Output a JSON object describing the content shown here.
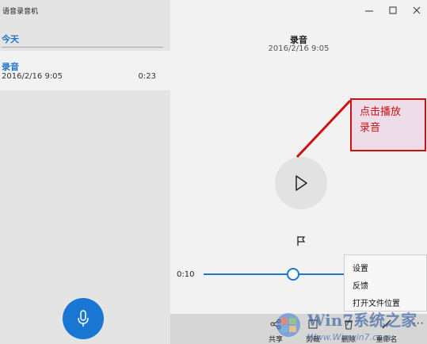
{
  "app": {
    "title": "语音录音机"
  },
  "sidebar": {
    "group_header": "今天",
    "recording": {
      "name": "录音",
      "date": "2016/2/16 9:05",
      "duration": "0:23"
    },
    "record_icon": "microphone-icon"
  },
  "window": {
    "minimize_icon": "minimize-icon",
    "maximize_icon": "maximize-icon",
    "close_icon": "close-icon"
  },
  "player": {
    "title": "录音",
    "subtitle": "2016/2/16 9:05",
    "play_icon": "play-icon",
    "marker_icon": "flag-icon",
    "current_time": "0:10",
    "progress": 0.43
  },
  "annotation": {
    "line1": "点击播放",
    "line2": "录音",
    "color": "#cc1111"
  },
  "context_menu": {
    "items": [
      "设置",
      "反馈",
      "打开文件位置"
    ]
  },
  "command_bar": {
    "share": "共享",
    "trim": "剪裁",
    "delete": "删除",
    "rename": "重命名",
    "more": "···"
  },
  "watermark": {
    "brand": "Win7系统之家",
    "url": "Www.Winwin7.com"
  },
  "colors": {
    "accent": "#1976d2",
    "pane": "#e4e4e4",
    "selected": "#f2f2f2"
  }
}
